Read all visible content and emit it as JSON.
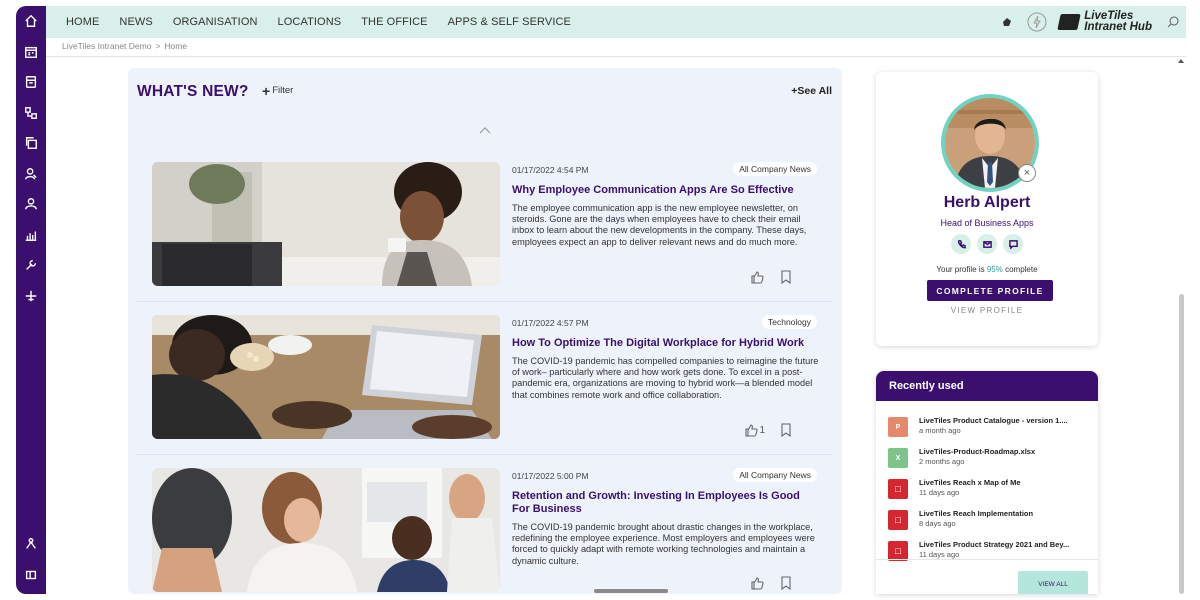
{
  "nav": {
    "items": [
      "HOME",
      "NEWS",
      "ORGANISATION",
      "LOCATIONS",
      "THE OFFICE",
      "APPS & SELF SERVICE"
    ],
    "logo_line1": "LiveTiles",
    "logo_line2": "Intranet Hub"
  },
  "breadcrumb": {
    "site": "LiveTiles Intranet Demo",
    "separator": ">",
    "page": "Home"
  },
  "rail_icons": [
    "home-icon",
    "calendar-icon",
    "notes-icon",
    "sitemap-icon",
    "copy-icon",
    "user-edit-icon",
    "user-icon",
    "chart-icon",
    "tools-icon",
    "plane-icon"
  ],
  "news": {
    "title": "WHAT'S NEW?",
    "filter_label": "Filter",
    "see_all": "+See All",
    "articles": [
      {
        "date": "01/17/2022 4:54 PM",
        "tag": "All Company News",
        "title": "Why Employee Communication Apps Are So Effective",
        "desc": "The employee communication app is the new employee newsletter, on steroids. Gone are the days when employees have to check their email inbox to learn about the new developments in the company. These days, employees expect an app to deliver relevant news and do much more.",
        "likes": ""
      },
      {
        "date": "01/17/2022 4:57 PM",
        "tag": "Technology",
        "title": "How To Optimize The Digital Workplace for Hybrid Work",
        "desc": "The COVID-19 pandemic has compelled companies to reimagine the future of work– particularly where and how work gets done. To excel in a post-pandemic era, organizations are moving to hybrid work—a blended model that combines remote work and office collaboration.",
        "likes": "1"
      },
      {
        "date": "01/17/2022 5:00 PM",
        "tag": "All Company News",
        "title": "Retention and Growth: Investing In Employees Is Good For Business",
        "desc": "The COVID-19 pandemic brought about drastic changes in the workplace, redefining the employee experience. Most employers and employees were forced to quickly adapt with remote working technologies and maintain a dynamic culture.",
        "likes": ""
      }
    ]
  },
  "profile": {
    "name": "Herb Alpert",
    "title": "Head of Business Apps",
    "complete_prefix": "Your profile is",
    "complete_pct": "95%",
    "complete_suffix": "complete",
    "complete_button": "COMPLETE PROFILE",
    "view_profile": "VIEW PROFILE"
  },
  "recent": {
    "title": "Recently used",
    "items": [
      {
        "name": "LiveTiles Product Catalogue - version 1....",
        "time": "a month ago",
        "type": "ppt",
        "color": "#e5896b"
      },
      {
        "name": "LiveTiles-Product-Roadmap.xlsx",
        "time": "2 months ago",
        "type": "xls",
        "color": "#7cc48a"
      },
      {
        "name": "LiveTiles Reach x Map of Me",
        "time": "11 days ago",
        "type": "pdf",
        "color": "#d6262f"
      },
      {
        "name": "LiveTiles Reach Implementation",
        "time": "8 days ago",
        "type": "pdf",
        "color": "#d6262f"
      },
      {
        "name": "LiveTiles Product Strategy 2021 and Bey...",
        "time": "11 days ago",
        "type": "pdf",
        "color": "#d6262f"
      }
    ],
    "view_all": "VIEW ALL"
  },
  "colors": {
    "brand": "#3a0f6e",
    "accent": "#6fd3c2",
    "nav_bg": "#d9efe9"
  }
}
